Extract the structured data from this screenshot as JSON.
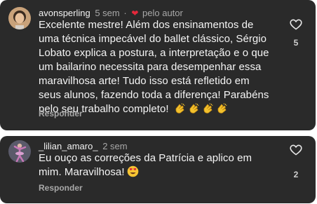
{
  "comments": [
    {
      "username": "avonsperling",
      "time": "5 sem",
      "separator": "·",
      "author_badge": "pelo autor",
      "lines": [
        "Excelente mestre! Além dos ensinamentos de",
        "uma técnica impecável do ballet clássico, Sérgio",
        "Lobato explica a postura, a interpretação e o que",
        "um bailarino necessita para desempenhar essa",
        "maravilhosa arte! Tudo isso está refletido em",
        "seus alunos, fazendo toda a diferença! Parabéns",
        "pelo seu  trabalho completo!"
      ],
      "emojis": [
        "clapping-hands",
        "clapping-hands",
        "clapping-hands",
        "clapping-hands"
      ],
      "reply_label": "Responder",
      "like_count": "5"
    },
    {
      "username": "_lilian_amaro_",
      "time": "2 sem",
      "lines": [
        "Eu ouço as correções da Patrícia e aplico em",
        "mim. Maravilhosa!"
      ],
      "emojis": [
        "heart-eyes-face"
      ],
      "reply_label": "Responder",
      "like_count": "2"
    }
  ],
  "colors": {
    "card_background": "#2a2a2a",
    "heart_red": "#e5283b",
    "muted_text": "#a8a8a8"
  }
}
